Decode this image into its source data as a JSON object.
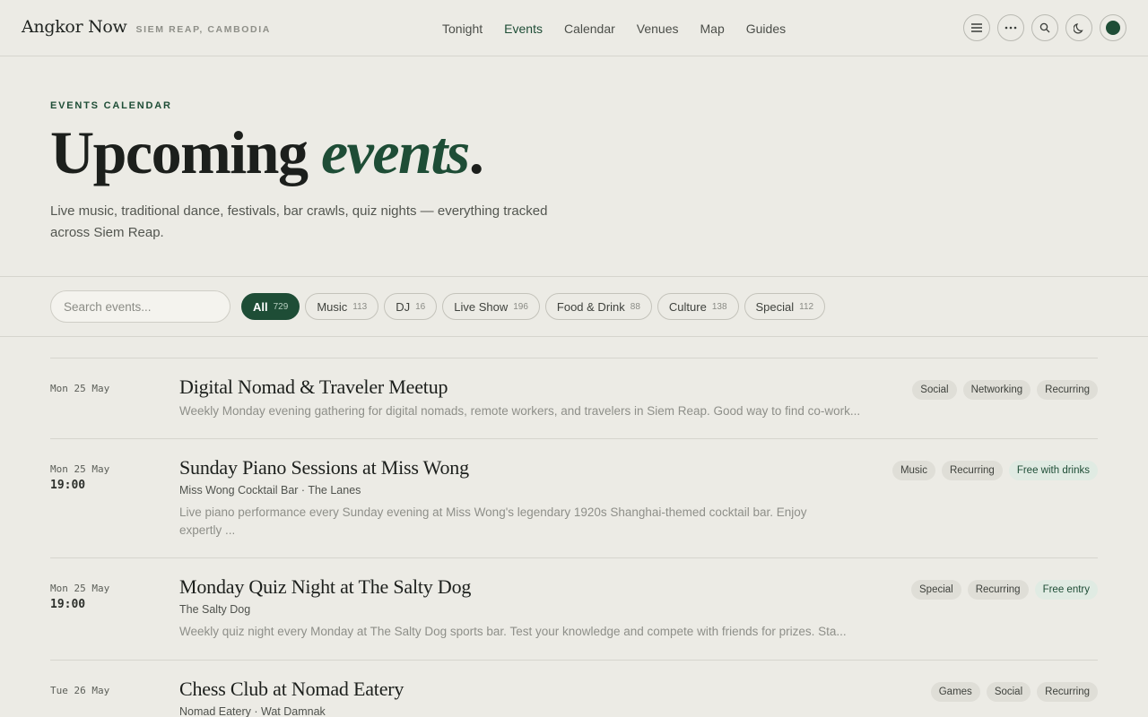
{
  "brand": {
    "name": "Angkor Now",
    "location": "SIEM REAP, CAMBODIA"
  },
  "nav": [
    {
      "label": "Tonight",
      "active": false
    },
    {
      "label": "Events",
      "active": true
    },
    {
      "label": "Calendar",
      "active": false
    },
    {
      "label": "Venues",
      "active": false
    },
    {
      "label": "Map",
      "active": false
    },
    {
      "label": "Guides",
      "active": false
    }
  ],
  "icons": {
    "menu": "≡",
    "more": "···",
    "search": "⌕",
    "theme": "☾"
  },
  "hero": {
    "eyebrow": "EVENTS CALENDAR",
    "title_main": "Upcoming ",
    "title_accent": "events",
    "title_end": ".",
    "description": "Live music, traditional dance, festivals, bar crawls, quiz nights — everything tracked across Siem Reap."
  },
  "filters": {
    "search_placeholder": "Search events...",
    "chips": [
      {
        "label": "All",
        "count": "729",
        "active": true
      },
      {
        "label": "Music",
        "count": "113",
        "active": false
      },
      {
        "label": "DJ",
        "count": "16",
        "active": false
      },
      {
        "label": "Live Show",
        "count": "196",
        "active": false
      },
      {
        "label": "Food & Drink",
        "count": "88",
        "active": false
      },
      {
        "label": "Culture",
        "count": "138",
        "active": false
      },
      {
        "label": "Special",
        "count": "112",
        "active": false
      }
    ]
  },
  "events": [
    {
      "date": "Mon 25 May",
      "time": "",
      "title": "Digital Nomad & Traveler Meetup",
      "venue": "",
      "description": "Weekly Monday evening gathering for digital nomads, remote workers, and travelers in Siem Reap. Good way to find co-work...",
      "tags": [
        "Social",
        "Networking",
        "Recurring"
      ]
    },
    {
      "date": "Mon 25 May",
      "time": "19:00",
      "title": "Sunday Piano Sessions at Miss Wong",
      "venue": "Miss Wong Cocktail Bar · The Lanes",
      "description": "Live piano performance every Sunday evening at Miss Wong's legendary 1920s Shanghai-themed cocktail bar. Enjoy expertly ...",
      "tags": [
        "Music",
        "Recurring",
        "Free with drinks"
      ]
    },
    {
      "date": "Mon 25 May",
      "time": "19:00",
      "title": "Monday Quiz Night at The Salty Dog",
      "venue": "The Salty Dog",
      "description": "Weekly quiz night every Monday at The Salty Dog sports bar. Test your knowledge and compete with friends for prizes. Sta...",
      "tags": [
        "Special",
        "Recurring",
        "Free entry"
      ]
    },
    {
      "date": "Tue 26 May",
      "time": "",
      "title": "Chess Club at Nomad Eatery",
      "venue": "Nomad Eatery · Wat Damnak",
      "description": "",
      "tags": [
        "Games",
        "Social",
        "Recurring"
      ]
    }
  ]
}
